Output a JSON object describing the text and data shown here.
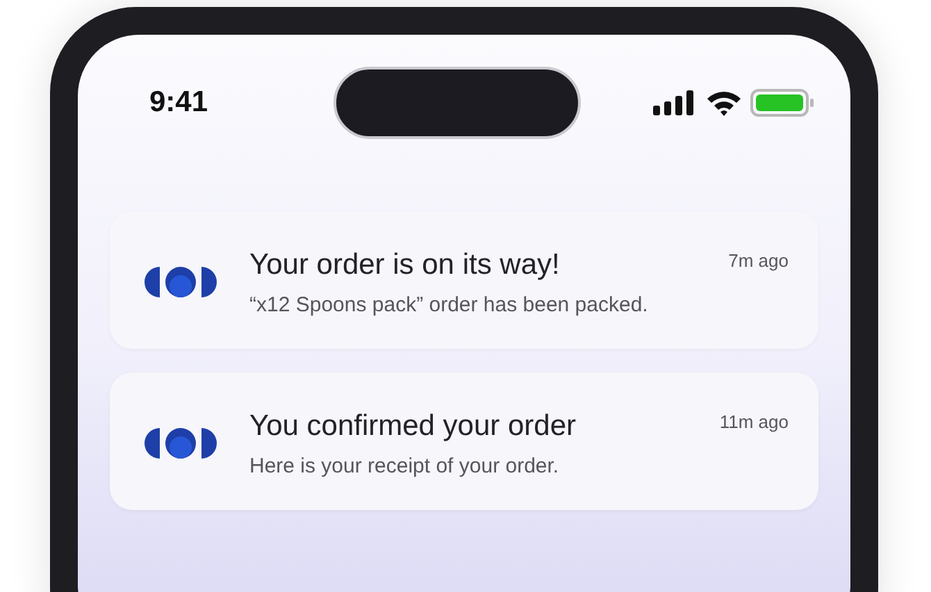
{
  "status_bar": {
    "time": "9:41"
  },
  "notifications": [
    {
      "title": "Your order is on its way!",
      "message": "“x12 Spoons pack” order has been packed.",
      "time": "7m ago"
    },
    {
      "title": "You confirmed your order",
      "message": "Here is your receipt of your order.",
      "time": "11m ago"
    }
  ]
}
